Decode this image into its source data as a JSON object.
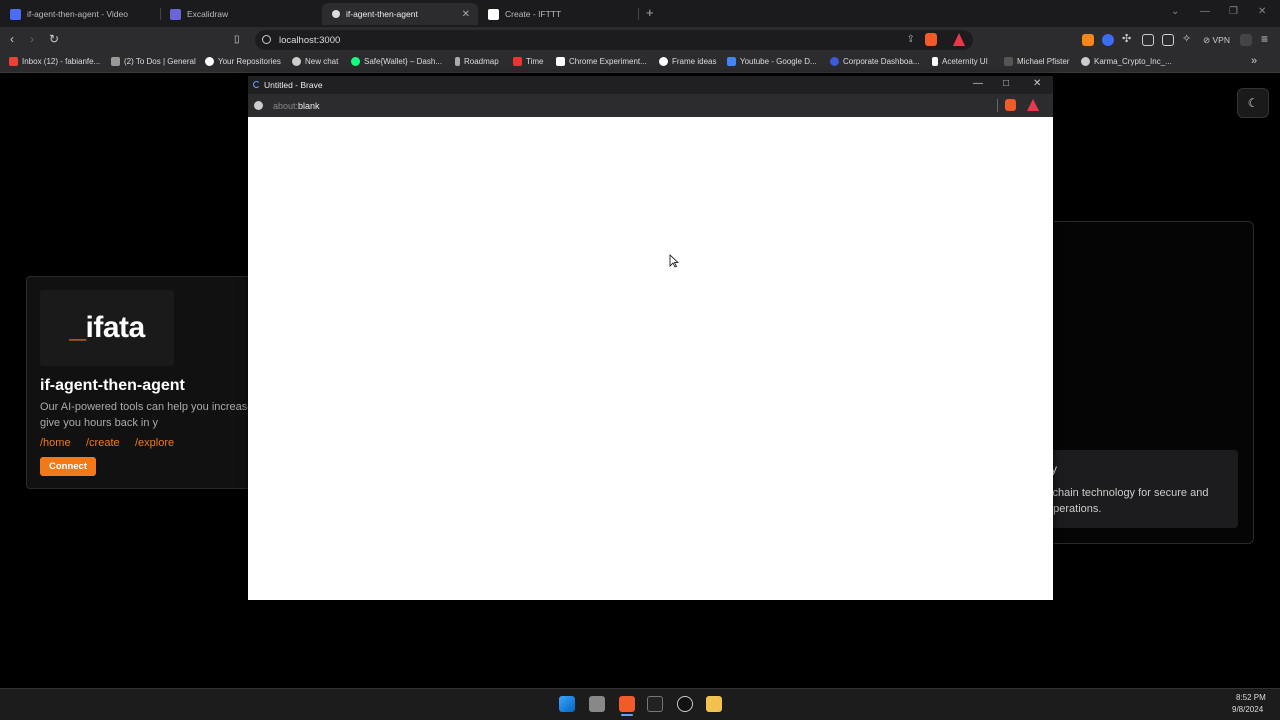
{
  "browser": {
    "tabs": [
      {
        "label": "if-agent-then-agent - Video",
        "favicon_color": "#4a6cf7"
      },
      {
        "label": "Excalidraw",
        "favicon_color": "#6965db"
      },
      {
        "label": "if-agent-then-agent",
        "favicon_color": "#dddddd",
        "active": true
      },
      {
        "label": "Create - IFTTT",
        "favicon_color": "#ffffff"
      }
    ],
    "new_tab_glyph": "+",
    "address": "localhost:3000",
    "vpn_label": "VPN",
    "bookmarks": [
      {
        "label": "Inbox (12) - fabianfe...",
        "icon_color": "#ea4335"
      },
      {
        "label": "(2) To Dos | General",
        "icon_color": "#999999"
      },
      {
        "label": "Your Repositories",
        "icon_color": "#ffffff"
      },
      {
        "label": "New chat",
        "icon_color": "#cccccc"
      },
      {
        "label": "Safe{Wallet} – Dash...",
        "icon_color": "#12ff80"
      },
      {
        "label": "Roadmap",
        "icon_color": "#aaaaaa"
      },
      {
        "label": "Time",
        "icon_color": "#e33"
      },
      {
        "label": "Chrome Experiment...",
        "icon_color": "#ffffff"
      },
      {
        "label": "Frame ideas",
        "icon_color": "#ffffff"
      },
      {
        "label": "Youtube - Google D...",
        "icon_color": "#4285f4"
      },
      {
        "label": "Corporate Dashboa...",
        "icon_color": "#3b5bdb"
      },
      {
        "label": "Aceternity UI",
        "icon_color": "#ffffff"
      },
      {
        "label": "Michael Pfister",
        "icon_color": "#555555"
      },
      {
        "label": "Karma_Crypto_Inc_...",
        "icon_color": "#cccccc"
      }
    ]
  },
  "page": {
    "theme_icon": "moon-icon",
    "card": {
      "title": "if-agent-then-agent",
      "description": "Our AI-powered tools can help you increase productivity and give you hours back in y",
      "links": [
        "/home",
        "/create",
        "/explore"
      ],
      "connect_label": "Connect"
    },
    "feature": {
      "heading_fragment": "y",
      "text": "kchain technology for secure and operations."
    },
    "accent": "#f07a1a"
  },
  "popup": {
    "title": "Untitled - Brave",
    "addr_prefix": "about:",
    "addr_value": "blank"
  },
  "taskbar": {
    "time": "8:52 PM",
    "date": "9/8/2024"
  }
}
